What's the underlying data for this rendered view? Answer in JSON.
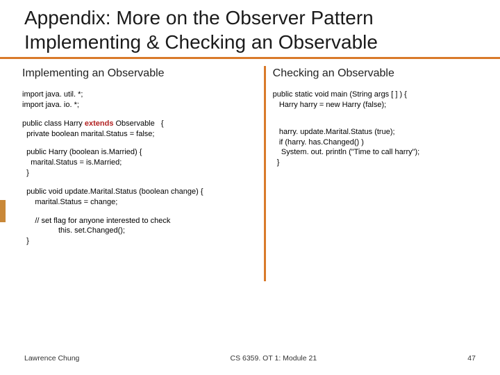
{
  "title": {
    "line1": "Appendix: More on the Observer Pattern",
    "line2": "Implementing & Checking an Observable"
  },
  "left": {
    "heading": "Implementing an Observable",
    "code1": "import java. util. *;\nimport java. io. *;",
    "code2a": "public class Harry ",
    "code2kw": "extends",
    "code2b": " Observable   {\n  private boolean marital.Status = false;",
    "code3": "  public Harry (boolean is.Married) {\n    marital.Status = is.Married;\n  }",
    "code4": "  public void update.Marital.Status (boolean change) {\n      marital.Status = change;",
    "code5": "      // set flag for anyone interested to check\n                 this. set.Changed();\n  }"
  },
  "right": {
    "heading": "Checking an Observable",
    "code1": "public static void main (String args [ ] ) {\n   Harry harry = new Harry (false);",
    "code2": "   harry. update.Marital.Status (true);\n   if (harry. has.Changed() )\n    System. out. println (\"Time to call harry\");\n  }"
  },
  "footer": {
    "left": "Lawrence Chung",
    "center": "CS 6359. OT 1: Module 21",
    "right": "47"
  }
}
